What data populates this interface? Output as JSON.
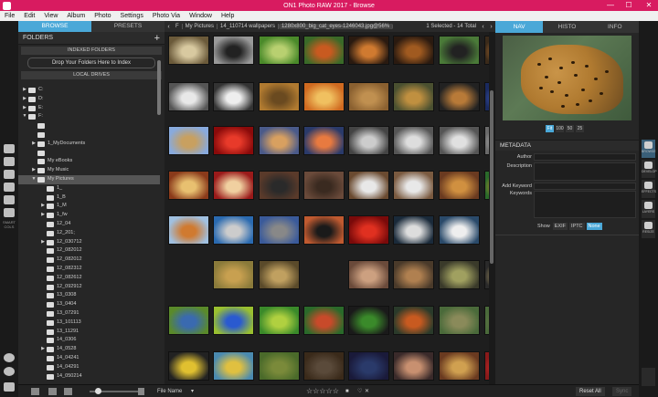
{
  "window": {
    "title": "ON1 Photo RAW 2017 - Browse",
    "min": "—",
    "max": "☐",
    "close": "✕"
  },
  "menu": [
    "File",
    "Edit",
    "View",
    "Album",
    "Photo",
    "Settings",
    "Photo Via",
    "Window",
    "Help"
  ],
  "left_tools": {
    "label": "SMART\nCOLS"
  },
  "left_panel": {
    "tabs": [
      {
        "label": "BROWSE",
        "active": true
      },
      {
        "label": "PRESETS",
        "active": false
      }
    ],
    "folders_title": "FOLDERS",
    "add_icon": "+",
    "indexed_title": "INDEXED FOLDERS",
    "dropzone": "Drop Your Folders Here to Index",
    "local_title": "LOCAL DRIVES",
    "tree": [
      {
        "label": "C:",
        "depth": 0,
        "arrow": "▶",
        "sel": false
      },
      {
        "label": "D:",
        "depth": 0,
        "arrow": "▶",
        "sel": false
      },
      {
        "label": "E:",
        "depth": 0,
        "arrow": "▶",
        "sel": false
      },
      {
        "label": "F:",
        "depth": 0,
        "arrow": "▼",
        "sel": false
      },
      {
        "label": "",
        "depth": 1,
        "arrow": "",
        "sel": false
      },
      {
        "label": "",
        "depth": 1,
        "arrow": "",
        "sel": false
      },
      {
        "label": "1_MyDocuments",
        "depth": 1,
        "arrow": "▶",
        "sel": false
      },
      {
        "label": "",
        "depth": 1,
        "arrow": "",
        "sel": false
      },
      {
        "label": "My eBooks",
        "depth": 1,
        "arrow": "",
        "sel": false
      },
      {
        "label": "My Music",
        "depth": 1,
        "arrow": "▶",
        "sel": false
      },
      {
        "label": "My Pictures",
        "depth": 1,
        "arrow": "▼",
        "sel": true
      },
      {
        "label": "1_",
        "depth": 2,
        "arrow": "",
        "sel": false
      },
      {
        "label": "1_B",
        "depth": 2,
        "arrow": "",
        "sel": false
      },
      {
        "label": "1_M",
        "depth": 2,
        "arrow": "▶",
        "sel": false
      },
      {
        "label": "1_fw",
        "depth": 2,
        "arrow": "▶",
        "sel": false
      },
      {
        "label": "12_04",
        "depth": 2,
        "arrow": "",
        "sel": false
      },
      {
        "label": "12_201;",
        "depth": 2,
        "arrow": "",
        "sel": false
      },
      {
        "label": "12_030712",
        "depth": 2,
        "arrow": "▶",
        "sel": false
      },
      {
        "label": "12_082012",
        "depth": 2,
        "arrow": "",
        "sel": false
      },
      {
        "label": "12_082012",
        "depth": 2,
        "arrow": "",
        "sel": false
      },
      {
        "label": "12_082312",
        "depth": 2,
        "arrow": "",
        "sel": false
      },
      {
        "label": "12_082612",
        "depth": 2,
        "arrow": "",
        "sel": false
      },
      {
        "label": "12_092912",
        "depth": 2,
        "arrow": "",
        "sel": false
      },
      {
        "label": "13_0308",
        "depth": 2,
        "arrow": "",
        "sel": false
      },
      {
        "label": "13_0404",
        "depth": 2,
        "arrow": "",
        "sel": false
      },
      {
        "label": "13_07291",
        "depth": 2,
        "arrow": "",
        "sel": false
      },
      {
        "label": "13_101113",
        "depth": 2,
        "arrow": "",
        "sel": false
      },
      {
        "label": "13_11291",
        "depth": 2,
        "arrow": "",
        "sel": false
      },
      {
        "label": "14_0306",
        "depth": 2,
        "arrow": "",
        "sel": false
      },
      {
        "label": "14_0528",
        "depth": 2,
        "arrow": "▶",
        "sel": false
      },
      {
        "label": "14_04241",
        "depth": 2,
        "arrow": "",
        "sel": false
      },
      {
        "label": "14_04291",
        "depth": 2,
        "arrow": "",
        "sel": false
      },
      {
        "label": "14_050214",
        "depth": 2,
        "arrow": "",
        "sel": false
      }
    ]
  },
  "pathbar": {
    "back": "‹",
    "crumbs": [
      "F",
      "My Pictures",
      "14_110714 wallpapers",
      "1280x800_big_cat_eyes-1246043.jpg@56%"
    ],
    "count": "1 Selected - 14 Total",
    "prev": "‹",
    "next": "›"
  },
  "thumbnails": {
    "rows": [
      [
        [
          "#6b5a3a",
          "#d8c9a0"
        ],
        [
          "#999999",
          "#222222"
        ],
        [
          "#4a8a2a",
          "#b8d070"
        ],
        [
          "#3a6a28",
          "#c85a20"
        ],
        [
          "#2a1a10",
          "#d07a30"
        ],
        [
          "#2a1a10",
          "#a05a20"
        ],
        [
          "#4a7a38",
          "#222222"
        ],
        [
          "#3a2a1a",
          "#c87a30"
        ]
      ],
      [
        [
          "#555555",
          "#e8e8e8"
        ],
        [
          "#333333",
          "#eeeeee"
        ],
        [
          "#b07a30",
          "#6a4a20"
        ],
        [
          "#d06a20",
          "#f0c060"
        ],
        [
          "#8a6030",
          "#c09050"
        ],
        [
          "#4a5030",
          "#c09040"
        ],
        [
          "#222222",
          "#b87a38"
        ],
        [
          "#1a2a60",
          "#4a6ad0"
        ]
      ],
      [
        [
          "#88aadd",
          "#c8a060"
        ],
        [
          "#8a0a0a",
          "#e83a2a"
        ],
        [
          "#4a5a8a",
          "#d8a060"
        ],
        [
          "#2a3a6a",
          "#e87a40"
        ],
        [
          "#444444",
          "#cccccc"
        ],
        [
          "#555555",
          "#dddddd"
        ],
        [
          "#555555",
          "#e0e0e0"
        ],
        [
          "#6a6a6a",
          "#cccccc"
        ]
      ],
      [
        [
          "#8a3a1a",
          "#e8c070"
        ],
        [
          "#9a1a1a",
          "#f0d0a0"
        ],
        [
          "#5a3a2a",
          "#2a2a2a"
        ],
        [
          "#6a4a3a",
          "#3a2a20"
        ],
        [
          "#6a4a30",
          "#e8e8e8"
        ],
        [
          "#7a5a40",
          "#e8e8e8"
        ],
        [
          "#6a3a20",
          "#d09040"
        ],
        [
          "#2a6a2a",
          "#e8a030"
        ]
      ],
      [
        [
          "#a0c0e0",
          "#d07a30"
        ],
        [
          "#2a6ab0",
          "#cccccc"
        ],
        [
          "#3a5a9a",
          "#888888"
        ],
        [
          "#c05a30",
          "#1a1a1a"
        ],
        [
          "#7a0a0a",
          "#e03020"
        ],
        [
          "#1a2a3a",
          "#dddddd"
        ],
        [
          "#2a4a6a",
          "#eeeeee"
        ],
        null
      ],
      [
        null,
        [
          "#8a7a3a",
          "#c8a050"
        ],
        [
          "#5a4a2a",
          "#c0a060"
        ],
        null,
        [
          "#6a4a3a",
          "#cca080"
        ],
        [
          "#4a3a2a",
          "#b08050"
        ],
        [
          "#3a3a2a",
          "#a0a060"
        ],
        [
          "#2a2a2a",
          "#c8b070"
        ]
      ],
      [
        [
          "#5a8a2a",
          "#3a6ab0"
        ],
        [
          "#9ac030",
          "#2a5ad0"
        ],
        [
          "#3a8a2a",
          "#b0d040"
        ],
        [
          "#2a6a2a",
          "#c84a2a"
        ],
        [
          "#1a1a1a",
          "#3a8a2a"
        ],
        [
          "#2a3a2a",
          "#c85a20"
        ],
        [
          "#4a6a3a",
          "#8a8a5a"
        ],
        [
          "#4a6a3a",
          "#6a7a4a"
        ]
      ],
      [
        [
          "#222222",
          "#e0c030"
        ],
        [
          "#4a8ab0",
          "#e0c040"
        ],
        [
          "#4a6a2a",
          "#7a8a3a"
        ],
        [
          "#3a2a1a",
          "#5a4a3a"
        ],
        [
          "#1a1a3a",
          "#2a3a6a"
        ],
        [
          "#3a2a2a",
          "#c89070"
        ],
        [
          "#6a3a20",
          "#d0a050"
        ],
        [
          "#8a1a1a",
          "#e83030"
        ]
      ]
    ]
  },
  "right_panel": {
    "tabs": [
      {
        "label": "NAV",
        "active": true
      },
      {
        "label": "HISTO",
        "active": false
      },
      {
        "label": "INFO",
        "active": false
      }
    ],
    "zoom": [
      {
        "label": "Fit",
        "active": true
      },
      {
        "label": "100",
        "active": false
      },
      {
        "label": "50",
        "active": false
      },
      {
        "label": "25",
        "active": false
      }
    ],
    "metadata_title": "METADATA",
    "fields": [
      {
        "label": "Author"
      },
      {
        "label": "Description"
      },
      {
        "label": "Add Keyword"
      },
      {
        "label": "Keywords"
      }
    ],
    "show_label": "Show",
    "show_opts": [
      {
        "label": "EXIF",
        "active": false
      },
      {
        "label": "IPTC",
        "active": false
      },
      {
        "label": "None",
        "active": true
      }
    ]
  },
  "right_tools": [
    {
      "name": "browse",
      "label": "BROWSE",
      "active": true
    },
    {
      "name": "develop",
      "label": "DEVELOP",
      "active": false
    },
    {
      "name": "effects",
      "label": "EFFECTS",
      "active": false
    },
    {
      "name": "layers",
      "label": "LAYERS",
      "active": false
    },
    {
      "name": "resize",
      "label": "RESIZE",
      "active": false
    }
  ],
  "bottom": {
    "sort": "File Name",
    "stars": "☆☆☆☆☆",
    "reset": "Reset All",
    "sync": "Sync"
  },
  "colors": {
    "accent": "#4aa8d8",
    "titlebar": "#d81b60"
  }
}
